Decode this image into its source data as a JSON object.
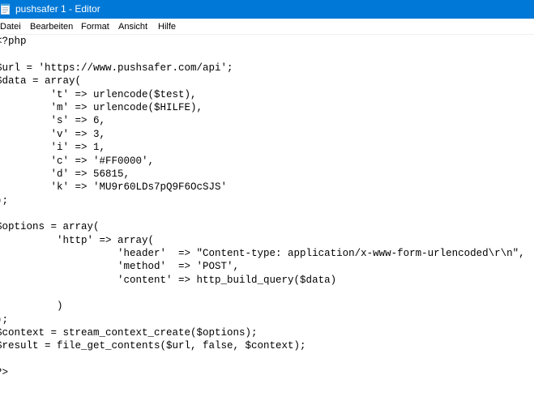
{
  "window": {
    "title": "pushsafer 1 - Editor",
    "title_bar_color": "#0078d7"
  },
  "menu": {
    "items": [
      "Datei",
      "Bearbeiten",
      "Format",
      "Ansicht",
      "Hilfe"
    ]
  },
  "icons": {
    "app": "notepad-icon"
  },
  "editor": {
    "lines": [
      "<?php",
      "",
      "$url = 'https://www.pushsafer.com/api';",
      "$data = array(",
      "         't' => urlencode($test),",
      "         'm' => urlencode($HILFE),",
      "         's' => 6,",
      "         'v' => 3,",
      "         'i' => 1,",
      "         'c' => '#FF0000',",
      "         'd' => 56815,",
      "         'k' => 'MU9r60LDs7pQ9F6OcSJS'",
      ");",
      "",
      "$options = array(",
      "          'http' => array(",
      "                    'header'  => \"Content-type: application/x-www-form-urlencoded\\r\\n\",",
      "                    'method'  => 'POST',",
      "                    'content' => http_build_query($data)",
      "",
      "          )",
      ");",
      "$context = stream_context_create($options);",
      "$result = file_get_contents($url, false, $context);",
      "",
      "?>"
    ]
  }
}
